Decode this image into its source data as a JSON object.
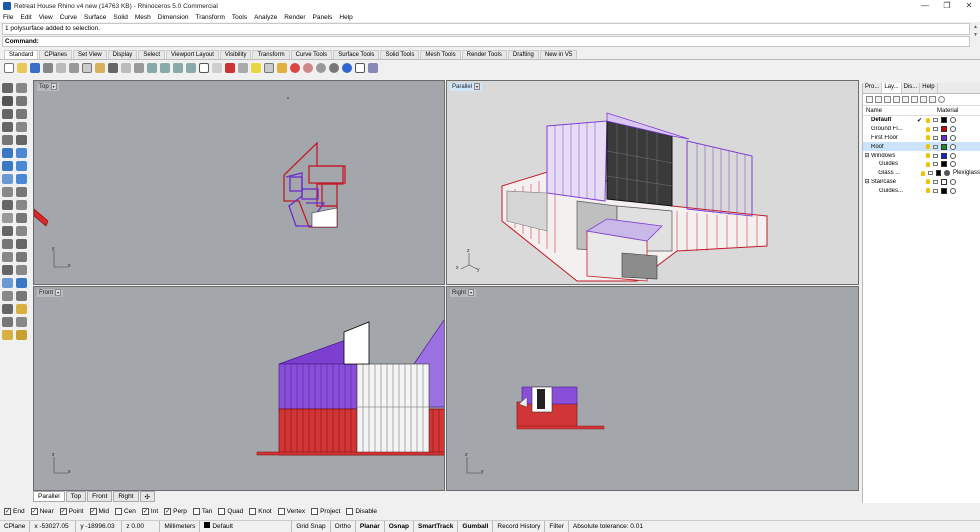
{
  "window": {
    "title": "Retreat House Rhino v4 new (14763 KB) - Rhinoceros 5.0 Commercial",
    "minimize": "—",
    "maximize": "❐",
    "close": "✕"
  },
  "menu": [
    "File",
    "Edit",
    "View",
    "Curve",
    "Surface",
    "Solid",
    "Mesh",
    "Dimension",
    "Transform",
    "Tools",
    "Analyze",
    "Render",
    "Panels",
    "Help"
  ],
  "command": {
    "history": "1 polysurface added to selection.",
    "prompt": "Command:",
    "value": ""
  },
  "toolbar_tabs": [
    "Standard",
    "CPlanes",
    "Set View",
    "Display",
    "Select",
    "Viewport Layout",
    "Visibility",
    "Transform",
    "Curve Tools",
    "Surface Tools",
    "Solid Tools",
    "Mesh Tools",
    "Render Tools",
    "Drafting",
    "New in V5"
  ],
  "toolbar_tabs_active": "Standard",
  "viewports": {
    "top": {
      "label": "Top"
    },
    "perspective": {
      "label": "Parallel"
    },
    "front": {
      "label": "Front"
    },
    "right": {
      "label": "Right"
    }
  },
  "axes": {
    "x": "x",
    "y": "y",
    "z": "z"
  },
  "viewport_tabs": [
    "Parallel",
    "Top",
    "Front",
    "Right",
    "✣"
  ],
  "osnap": [
    {
      "label": "End",
      "checked": true
    },
    {
      "label": "Near",
      "checked": true
    },
    {
      "label": "Point",
      "checked": true
    },
    {
      "label": "Mid",
      "checked": true
    },
    {
      "label": "Cen",
      "checked": false
    },
    {
      "label": "Int",
      "checked": true
    },
    {
      "label": "Perp",
      "checked": true
    },
    {
      "label": "Tan",
      "checked": false
    },
    {
      "label": "Quad",
      "checked": false
    },
    {
      "label": "Knot",
      "checked": false
    },
    {
      "label": "Vertex",
      "checked": false
    },
    {
      "label": "Project",
      "checked": false
    },
    {
      "label": "Disable",
      "checked": false
    }
  ],
  "status": {
    "cplane": "CPlane",
    "x": "x -53027.05",
    "y": "y -18996.03",
    "z": "z 0.00",
    "units": "Millimeters",
    "layer": "Default",
    "grid_snap": "Grid Snap",
    "ortho": "Ortho",
    "planar": "Planar",
    "osnap": "Osnap",
    "smarttrack": "SmartTrack",
    "gumball": "Gumball",
    "record_history": "Record History",
    "filter": "Filter",
    "tolerance": "Absolute tolerance: 0.01"
  },
  "panel": {
    "tabs": [
      "Pro...",
      "Lay...",
      "Dis...",
      "Help"
    ],
    "col_name": "Name",
    "col_material": "Material",
    "layers": [
      {
        "name": "Default",
        "check": "✔",
        "color": "#000000",
        "material": "",
        "bold": true,
        "indent": 0,
        "expander": ""
      },
      {
        "name": "Ground Fl...",
        "check": "",
        "color": "#d10000",
        "material": "",
        "bold": false,
        "indent": 0,
        "expander": ""
      },
      {
        "name": "First Floor",
        "check": "",
        "color": "#6b2ccf",
        "material": "",
        "bold": false,
        "indent": 0,
        "expander": ""
      },
      {
        "name": "Roof",
        "check": "",
        "color": "#1a8c1a",
        "material": "",
        "bold": false,
        "indent": 0,
        "expander": "",
        "selected": true
      },
      {
        "name": "Windows",
        "check": "",
        "color": "#1522c4",
        "material": "",
        "bold": false,
        "indent": 0,
        "expander": "⊟"
      },
      {
        "name": "Guides",
        "check": "",
        "color": "#000000",
        "material": "",
        "bold": false,
        "indent": 1,
        "expander": ""
      },
      {
        "name": "Glass ...",
        "check": "",
        "color": "#000000",
        "material": "Plexiglass",
        "bold": false,
        "indent": 1,
        "expander": ""
      },
      {
        "name": "Staircase",
        "check": "",
        "color": "#ffffff",
        "material": "",
        "bold": false,
        "indent": 0,
        "expander": "⊟"
      },
      {
        "name": "Guides...",
        "check": "",
        "color": "#000000",
        "material": "",
        "bold": false,
        "indent": 1,
        "expander": ""
      }
    ]
  },
  "colors": {
    "viewport_bg": "#a3a7ab",
    "red": "#cc1f1f",
    "purple": "#7d3fd0",
    "white": "#ffffff"
  }
}
